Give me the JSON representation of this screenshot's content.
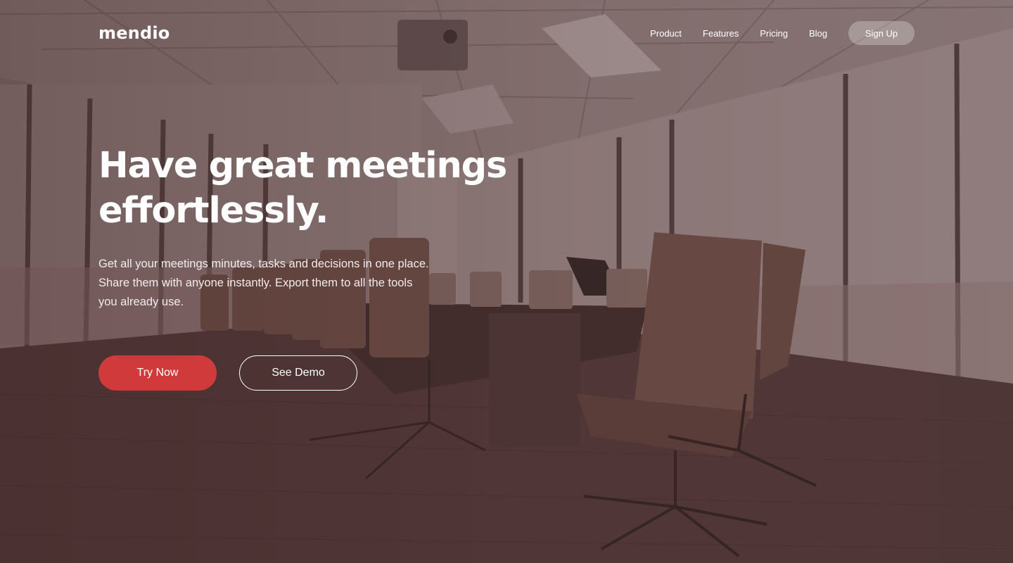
{
  "brand": {
    "logo_text": "mendio"
  },
  "nav": {
    "items": [
      {
        "label": "Product"
      },
      {
        "label": "Features"
      },
      {
        "label": "Pricing"
      },
      {
        "label": "Blog"
      }
    ],
    "signup_label": "Sign Up"
  },
  "hero": {
    "headline_line1": "Have great meetings",
    "headline_line2": "effortlessly.",
    "subheadline": "Get all your meetings minutes, tasks and decisions in one place. Share them with anyone instantly. Export them to all the tools you already use.",
    "primary_cta": "Try Now",
    "secondary_cta": "See Demo",
    "background_image": "conference-room-photo"
  },
  "colors": {
    "accent": "#d13a3a",
    "overlay_tint": "#5a3a3a"
  }
}
